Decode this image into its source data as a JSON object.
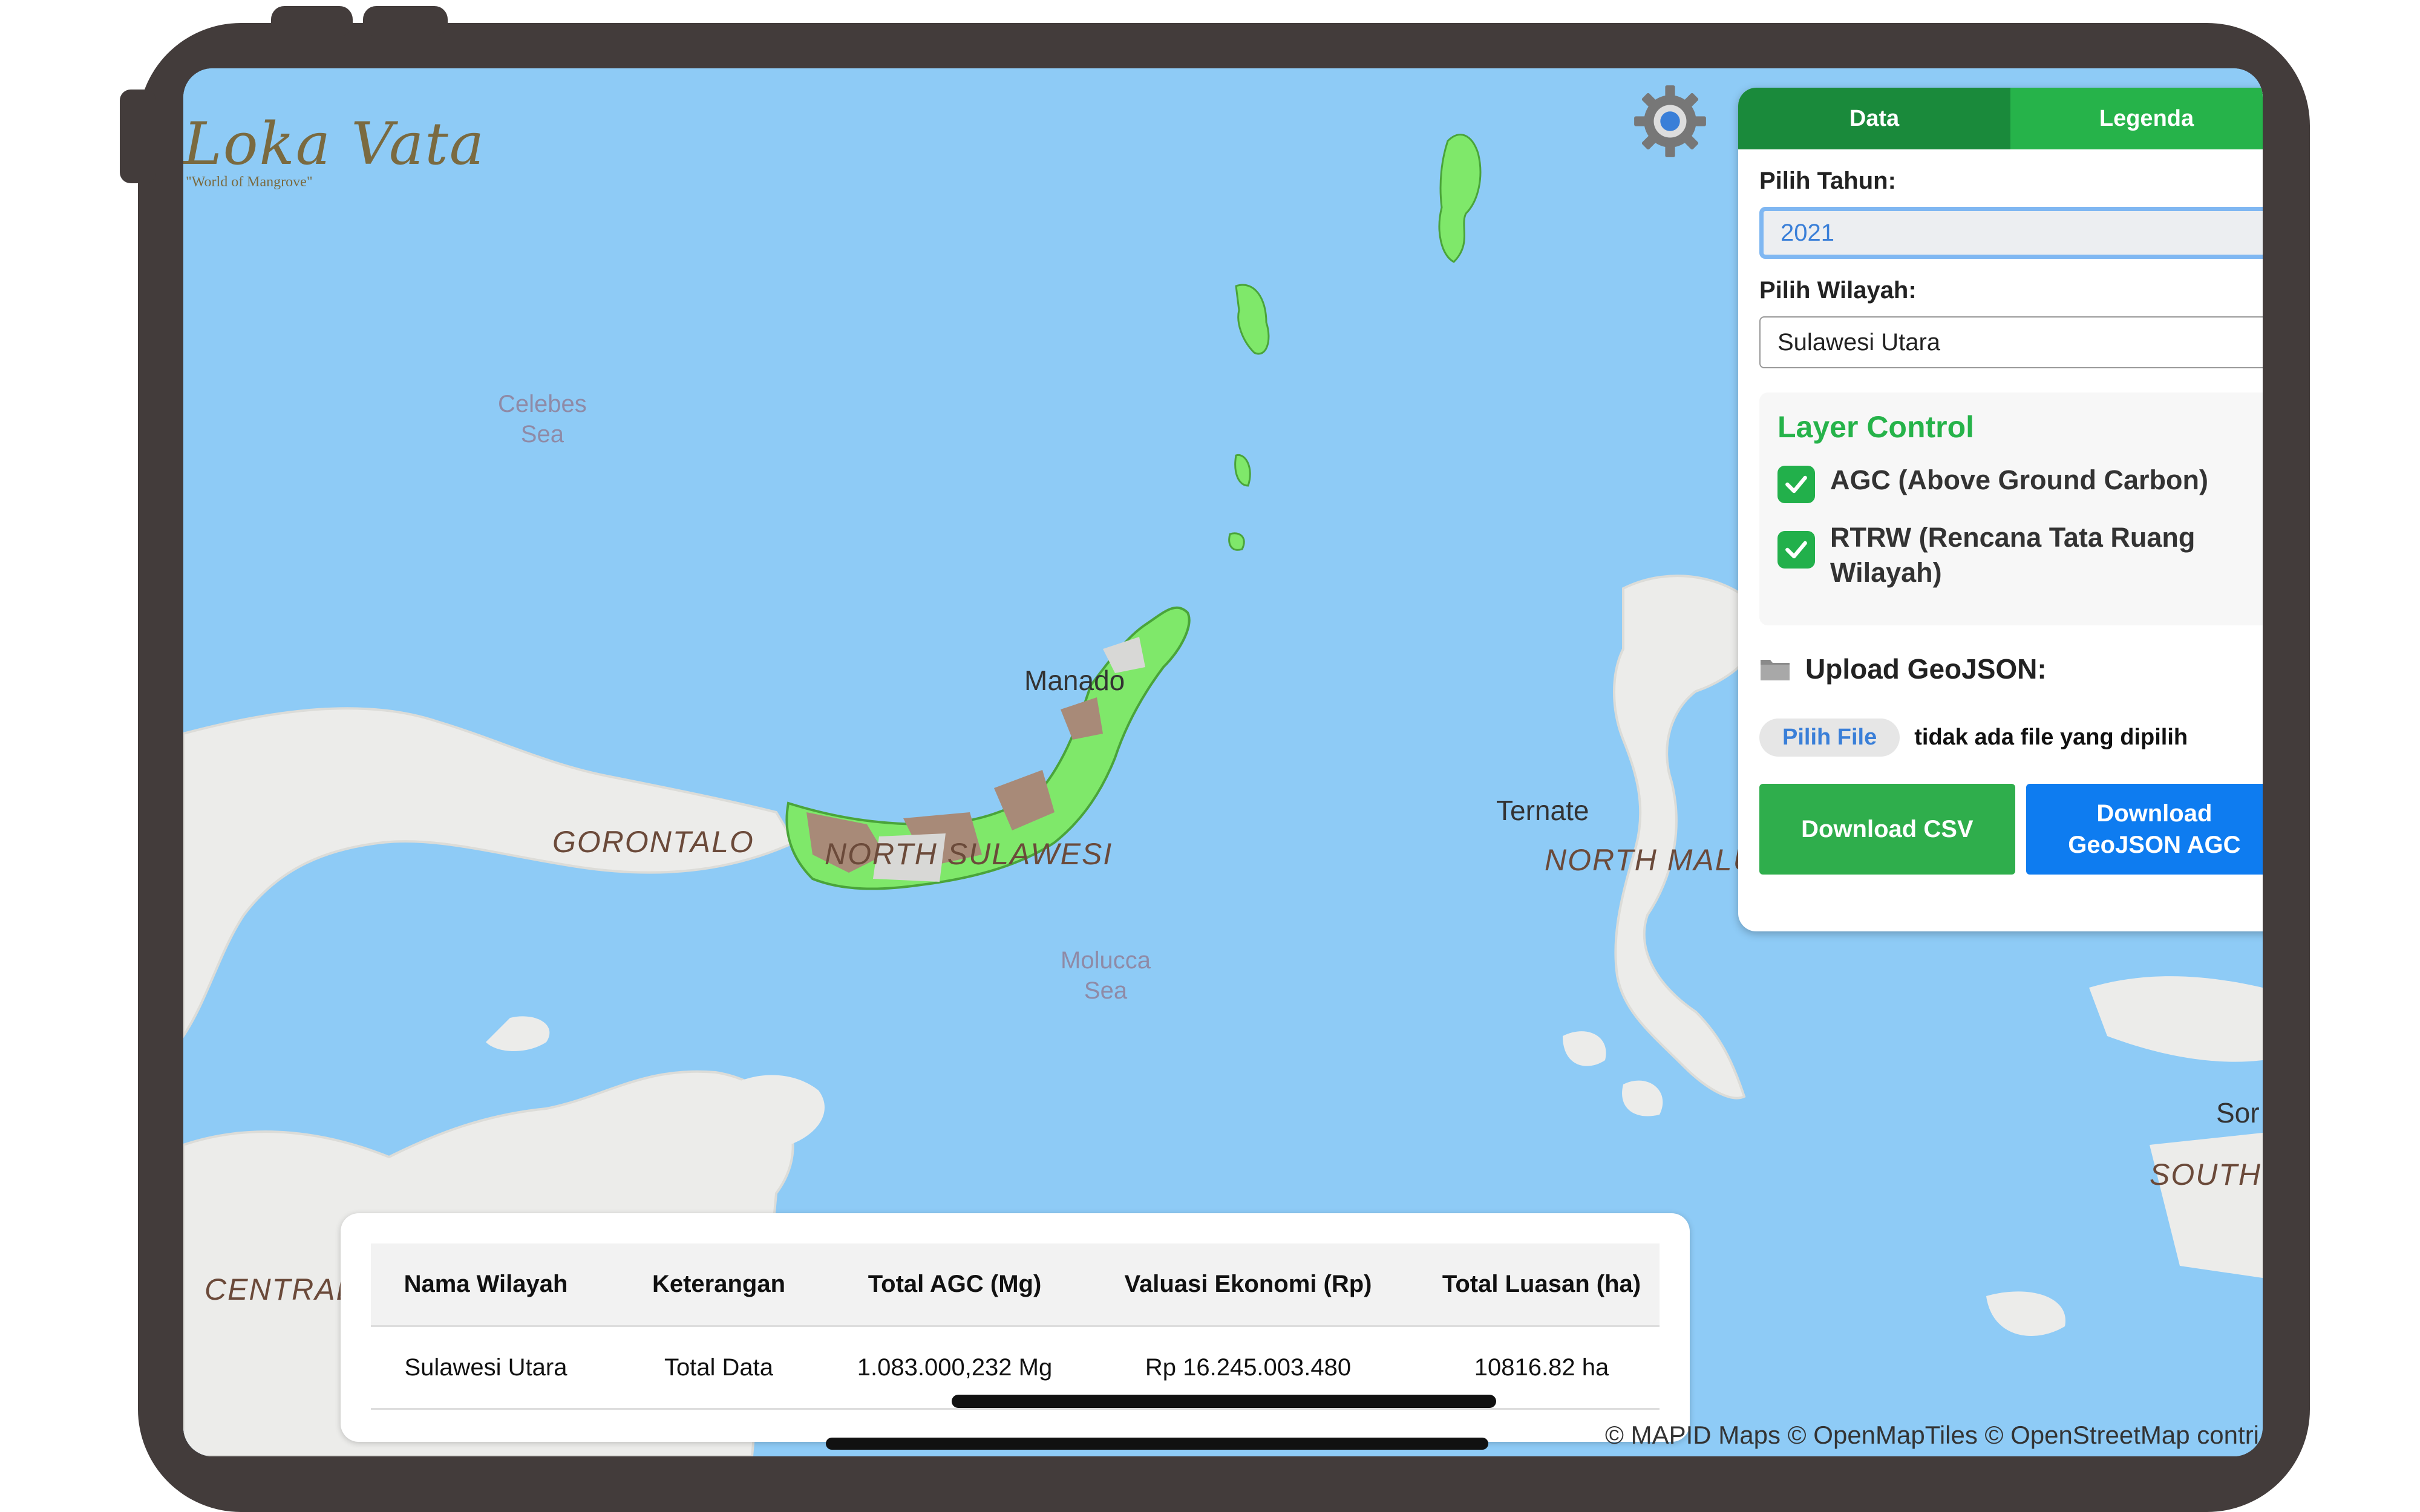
{
  "logo": {
    "title": "Loka Vata",
    "subtitle": "\"World of Mangrove\""
  },
  "map": {
    "labels": {
      "celebes": "Celebes\nSea",
      "molucca": "Molucca\nSea",
      "manado": "Manado",
      "ternate": "Ternate",
      "gorontalo": "GORONTALO",
      "north_sulawesi": "NORTH SULAWESI",
      "north_maluku": "NORTH MALU",
      "central_s": "CENTRAL S",
      "southw": "SOUTHW",
      "sor": "Sor"
    },
    "attribution": "© MAPID Maps © OpenMapTiles © OpenStreetMap contri"
  },
  "panel": {
    "tabs": [
      "Data",
      "Legenda"
    ],
    "year_label": "Pilih Tahun:",
    "year_value": "2021",
    "region_label": "Pilih Wilayah:",
    "region_value": "Sulawesi Utara",
    "layer_control": {
      "title": "Layer Control",
      "layers": [
        {
          "label": "AGC (Above Ground Carbon)",
          "checked": true
        },
        {
          "label": "RTRW (Rencana Tata Ruang Wilayah)",
          "checked": true
        }
      ]
    },
    "upload_label": "Upload GeoJSON:",
    "file_button": "Pilih File",
    "file_status": "tidak ada file yang dipilih",
    "download_csv": "Download CSV",
    "download_geojson": "Download GeoJSON AGC"
  },
  "table": {
    "headers": [
      "Nama Wilayah",
      "Keterangan",
      "Total AGC (Mg)",
      "Valuasi Ekonomi (Rp)",
      "Total Luasan (ha)"
    ],
    "rows": [
      [
        "Sulawesi Utara",
        "Total Data",
        "1.083.000,232 Mg",
        "Rp 16.245.003.480",
        "10816.82 ha"
      ]
    ]
  },
  "colors": {
    "tab_active": "#1a8a3b",
    "tab_inactive": "#26b34a",
    "csv": "#2fae4c",
    "geojson": "#0e7cf0",
    "sea": "#8ecbf6",
    "mangrove": "#7fe86a",
    "rtrw": "#a88a78"
  },
  "icons": [
    "gear-icon",
    "checkbox-checked-icon",
    "folder-icon"
  ]
}
